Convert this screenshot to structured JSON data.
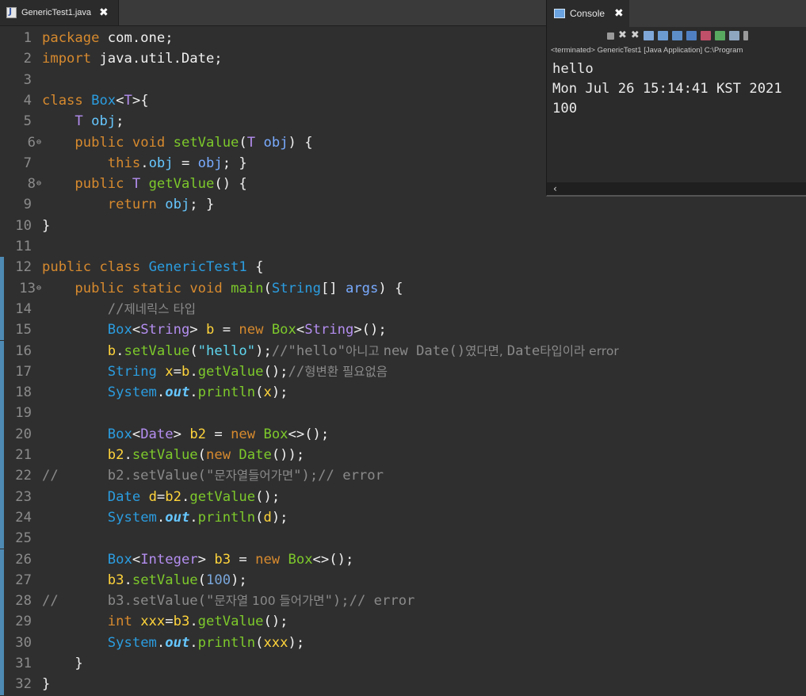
{
  "editor_tab": {
    "label": "GenericTest1.java",
    "close": "✖"
  },
  "console": {
    "tab_label": "Console",
    "close": "✖",
    "status": "<terminated> GenericTest1 [Java Application] C:\\Program",
    "output": [
      "hello",
      "Mon Jul 26 15:14:41 KST 2021",
      "100"
    ],
    "scroll_left": "‹"
  },
  "colors": {
    "keyword": "#d78a2e",
    "class": "#2b9de0",
    "method": "#7dc92b",
    "comment": "#8a8a8a",
    "string": "#5fd7f0",
    "background": "#2f2f2f"
  },
  "lines": [
    {
      "n": "1",
      "marker": "",
      "hl": false,
      "t": [
        [
          "kw",
          "package"
        ],
        [
          "pl",
          " com.one;"
        ]
      ]
    },
    {
      "n": "2",
      "marker": "",
      "hl": false,
      "t": [
        [
          "kw",
          "import"
        ],
        [
          "pl",
          " java.util.Date;"
        ]
      ]
    },
    {
      "n": "3",
      "marker": "",
      "hl": false,
      "t": []
    },
    {
      "n": "4",
      "marker": "",
      "hl": false,
      "t": [
        [
          "kw",
          "class"
        ],
        [
          "pl",
          " "
        ],
        [
          "cl",
          "Box"
        ],
        [
          "pl",
          "<"
        ],
        [
          "tp",
          "T"
        ],
        [
          "pl",
          ">{"
        ]
      ]
    },
    {
      "n": "5",
      "marker": "",
      "hl": false,
      "t": [
        [
          "pl",
          "    "
        ],
        [
          "tp",
          "T"
        ],
        [
          "pl",
          " "
        ],
        [
          "fld",
          "obj"
        ],
        [
          "pl",
          ";"
        ]
      ]
    },
    {
      "n": "6",
      "marker": "⊖",
      "hl": false,
      "t": [
        [
          "pl",
          "    "
        ],
        [
          "kw",
          "public"
        ],
        [
          "pl",
          " "
        ],
        [
          "kw",
          "void"
        ],
        [
          "pl",
          " "
        ],
        [
          "fn",
          "setValue"
        ],
        [
          "pl",
          "("
        ],
        [
          "tp",
          "T"
        ],
        [
          "pl",
          " "
        ],
        [
          "var",
          "obj"
        ],
        [
          "pl",
          ") {"
        ]
      ]
    },
    {
      "n": "7",
      "marker": "",
      "hl": false,
      "t": [
        [
          "pl",
          "        "
        ],
        [
          "kw",
          "this"
        ],
        [
          "pl",
          "."
        ],
        [
          "fld",
          "obj"
        ],
        [
          "pl",
          " = "
        ],
        [
          "var",
          "obj"
        ],
        [
          "pl",
          "; }"
        ]
      ]
    },
    {
      "n": "8",
      "marker": "⊖",
      "hl": false,
      "t": [
        [
          "pl",
          "    "
        ],
        [
          "kw",
          "public"
        ],
        [
          "pl",
          " "
        ],
        [
          "tp",
          "T"
        ],
        [
          "pl",
          " "
        ],
        [
          "fn",
          "getValue"
        ],
        [
          "pl",
          "() {"
        ]
      ]
    },
    {
      "n": "9",
      "marker": "",
      "hl": false,
      "t": [
        [
          "pl",
          "        "
        ],
        [
          "kw",
          "return"
        ],
        [
          "pl",
          " "
        ],
        [
          "fld",
          "obj"
        ],
        [
          "pl",
          "; }"
        ]
      ]
    },
    {
      "n": "10",
      "marker": "",
      "hl": false,
      "t": [
        [
          "pl",
          "}"
        ]
      ]
    },
    {
      "n": "11",
      "marker": "",
      "hl": false,
      "t": []
    },
    {
      "n": "12",
      "marker": "",
      "hl": true,
      "t": [
        [
          "kw",
          "public"
        ],
        [
          "pl",
          " "
        ],
        [
          "kw",
          "class"
        ],
        [
          "pl",
          " "
        ],
        [
          "cl",
          "GenericTest1"
        ],
        [
          "pl",
          " {"
        ]
      ]
    },
    {
      "n": "13",
      "marker": "⊖",
      "hl": true,
      "t": [
        [
          "pl",
          "    "
        ],
        [
          "kw",
          "public"
        ],
        [
          "pl",
          " "
        ],
        [
          "kw",
          "static"
        ],
        [
          "pl",
          " "
        ],
        [
          "kw",
          "void"
        ],
        [
          "pl",
          " "
        ],
        [
          "fn",
          "main"
        ],
        [
          "pl",
          "("
        ],
        [
          "cl",
          "String"
        ],
        [
          "pl",
          "[] "
        ],
        [
          "var",
          "args"
        ],
        [
          "pl",
          ") {"
        ]
      ]
    },
    {
      "n": "14",
      "marker": "",
      "hl": true,
      "t": [
        [
          "pl",
          "        "
        ],
        [
          "cm",
          "//"
        ],
        [
          "cmk",
          "제네릭스 타입"
        ]
      ]
    },
    {
      "n": "15",
      "marker": "",
      "hl": true,
      "t": [
        [
          "pl",
          "        "
        ],
        [
          "cl",
          "Box"
        ],
        [
          "pl",
          "<"
        ],
        [
          "tp",
          "String"
        ],
        [
          "pl",
          "> "
        ],
        [
          "lv",
          "b"
        ],
        [
          "pl",
          " = "
        ],
        [
          "kw",
          "new"
        ],
        [
          "pl",
          " "
        ],
        [
          "fn",
          "Box"
        ],
        [
          "pl",
          "<"
        ],
        [
          "tp",
          "String"
        ],
        [
          "pl",
          ">();"
        ]
      ]
    },
    {
      "n": "16",
      "marker": "",
      "hl": true,
      "t": [
        [
          "pl",
          "        "
        ],
        [
          "lv",
          "b"
        ],
        [
          "pl",
          "."
        ],
        [
          "fn",
          "setValue"
        ],
        [
          "pl",
          "("
        ],
        [
          "str",
          "\"hello\""
        ],
        [
          "pl",
          ");"
        ],
        [
          "cm",
          "//\"hello\""
        ],
        [
          "cmk",
          "아니고 "
        ],
        [
          "cm",
          "new Date()"
        ],
        [
          "cmk",
          "였다면, "
        ],
        [
          "cm",
          "Date"
        ],
        [
          "cmk",
          "타입이라 error"
        ]
      ]
    },
    {
      "n": "17",
      "marker": "",
      "hl": true,
      "t": [
        [
          "pl",
          "        "
        ],
        [
          "cl",
          "String"
        ],
        [
          "pl",
          " "
        ],
        [
          "lv",
          "x"
        ],
        [
          "pl",
          "="
        ],
        [
          "lv",
          "b"
        ],
        [
          "pl",
          "."
        ],
        [
          "fn",
          "getValue"
        ],
        [
          "pl",
          "();"
        ],
        [
          "cm",
          "//"
        ],
        [
          "cmk",
          "형변환 필요없음"
        ]
      ]
    },
    {
      "n": "18",
      "marker": "",
      "hl": true,
      "t": [
        [
          "pl",
          "        "
        ],
        [
          "cl",
          "System"
        ],
        [
          "pl",
          "."
        ],
        [
          "out",
          "out"
        ],
        [
          "pl",
          "."
        ],
        [
          "fn",
          "println"
        ],
        [
          "pl",
          "("
        ],
        [
          "lv",
          "x"
        ],
        [
          "pl",
          ");"
        ]
      ]
    },
    {
      "n": "19",
      "marker": "",
      "hl": true,
      "t": []
    },
    {
      "n": "20",
      "marker": "",
      "hl": true,
      "t": [
        [
          "pl",
          "        "
        ],
        [
          "cl",
          "Box"
        ],
        [
          "pl",
          "<"
        ],
        [
          "tp",
          "Date"
        ],
        [
          "pl",
          "> "
        ],
        [
          "lv",
          "b2"
        ],
        [
          "pl",
          " = "
        ],
        [
          "kw",
          "new"
        ],
        [
          "pl",
          " "
        ],
        [
          "fn",
          "Box"
        ],
        [
          "pl",
          "<>();"
        ]
      ]
    },
    {
      "n": "21",
      "marker": "",
      "hl": true,
      "t": [
        [
          "pl",
          "        "
        ],
        [
          "lv",
          "b2"
        ],
        [
          "pl",
          "."
        ],
        [
          "fn",
          "setValue"
        ],
        [
          "pl",
          "("
        ],
        [
          "kw",
          "new"
        ],
        [
          "pl",
          " "
        ],
        [
          "fn",
          "Date"
        ],
        [
          "pl",
          "());"
        ]
      ]
    },
    {
      "n": "22",
      "marker": "",
      "hl": true,
      "t": [
        [
          "cm",
          "//      b2.setValue(\""
        ],
        [
          "cmk",
          "문자열들어가면"
        ],
        [
          "cm",
          "\");// error"
        ]
      ]
    },
    {
      "n": "23",
      "marker": "",
      "hl": true,
      "t": [
        [
          "pl",
          "        "
        ],
        [
          "cl",
          "Date"
        ],
        [
          "pl",
          " "
        ],
        [
          "lv",
          "d"
        ],
        [
          "pl",
          "="
        ],
        [
          "lv",
          "b2"
        ],
        [
          "pl",
          "."
        ],
        [
          "fn",
          "getValue"
        ],
        [
          "pl",
          "();"
        ]
      ]
    },
    {
      "n": "24",
      "marker": "",
      "hl": true,
      "t": [
        [
          "pl",
          "        "
        ],
        [
          "cl",
          "System"
        ],
        [
          "pl",
          "."
        ],
        [
          "out",
          "out"
        ],
        [
          "pl",
          "."
        ],
        [
          "fn",
          "println"
        ],
        [
          "pl",
          "("
        ],
        [
          "lv",
          "d"
        ],
        [
          "pl",
          ");"
        ]
      ]
    },
    {
      "n": "25",
      "marker": "",
      "hl": true,
      "t": []
    },
    {
      "n": "26",
      "marker": "",
      "hl": true,
      "t": [
        [
          "pl",
          "        "
        ],
        [
          "cl",
          "Box"
        ],
        [
          "pl",
          "<"
        ],
        [
          "tp",
          "Integer"
        ],
        [
          "pl",
          "> "
        ],
        [
          "lv",
          "b3"
        ],
        [
          "pl",
          " = "
        ],
        [
          "kw",
          "new"
        ],
        [
          "pl",
          " "
        ],
        [
          "fn",
          "Box"
        ],
        [
          "pl",
          "<>();"
        ]
      ]
    },
    {
      "n": "27",
      "marker": "",
      "hl": true,
      "t": [
        [
          "pl",
          "        "
        ],
        [
          "lv",
          "b3"
        ],
        [
          "pl",
          "."
        ],
        [
          "fn",
          "setValue"
        ],
        [
          "pl",
          "("
        ],
        [
          "num",
          "100"
        ],
        [
          "pl",
          ");"
        ]
      ]
    },
    {
      "n": "28",
      "marker": "",
      "hl": true,
      "t": [
        [
          "cm",
          "//      b3.setValue(\""
        ],
        [
          "cmk",
          "문자열 100 들어가면"
        ],
        [
          "cm",
          "\");// error"
        ]
      ]
    },
    {
      "n": "29",
      "marker": "",
      "hl": true,
      "t": [
        [
          "pl",
          "        "
        ],
        [
          "kw",
          "int"
        ],
        [
          "pl",
          " "
        ],
        [
          "lv",
          "xxx"
        ],
        [
          "pl",
          "="
        ],
        [
          "lv",
          "b3"
        ],
        [
          "pl",
          "."
        ],
        [
          "fn",
          "getValue"
        ],
        [
          "pl",
          "();"
        ]
      ]
    },
    {
      "n": "30",
      "marker": "",
      "hl": true,
      "t": [
        [
          "pl",
          "        "
        ],
        [
          "cl",
          "System"
        ],
        [
          "pl",
          "."
        ],
        [
          "out",
          "out"
        ],
        [
          "pl",
          "."
        ],
        [
          "fn",
          "println"
        ],
        [
          "pl",
          "("
        ],
        [
          "lv",
          "xxx"
        ],
        [
          "pl",
          ");"
        ]
      ]
    },
    {
      "n": "31",
      "marker": "",
      "hl": true,
      "t": [
        [
          "pl",
          "    }"
        ]
      ]
    },
    {
      "n": "32",
      "marker": "",
      "hl": true,
      "t": [
        [
          "pl",
          "}"
        ]
      ]
    }
  ]
}
